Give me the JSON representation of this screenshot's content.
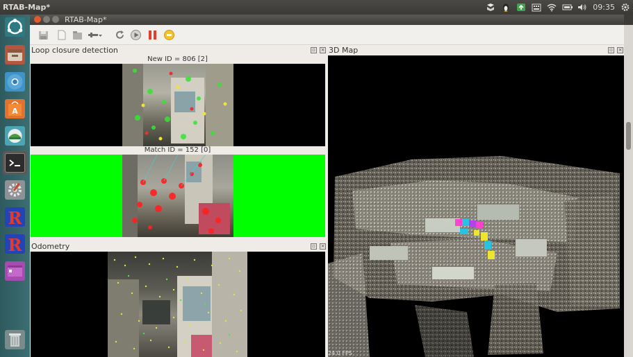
{
  "topbar": {
    "app_title": "RTAB-Map*",
    "time": "09:35",
    "icons": [
      "dropbox-icon",
      "tux-icon",
      "updater-icon",
      "keyboard-icon",
      "wifi-icon",
      "battery-icon",
      "volume-icon",
      "gear-icon"
    ]
  },
  "launcher": {
    "items": [
      "ubuntu-dash-icon",
      "files-icon",
      "chromium-icon",
      "software-center-icon",
      "system-monitor-icon",
      "terminal-icon",
      "system-settings-icon",
      "rtabmap-icon",
      "rtabmap-icon-2",
      "workspace-icon",
      "trash-icon"
    ]
  },
  "window": {
    "title": "RTAB-Map*"
  },
  "toolbar": {
    "buttons": [
      "save-icon",
      "new-icon",
      "open-icon",
      "dropdown-icon",
      "refresh-icon",
      "play-icon",
      "pause-icon",
      "stop-icon"
    ]
  },
  "loop_dock": {
    "title": "Loop closure detection",
    "new_id": "New ID = 806 [2]",
    "match_id": "Match ID = 152 [0]"
  },
  "odom_dock": {
    "title": "Odometry"
  },
  "map_dock": {
    "title": "3D Map",
    "fps": "24.0 FPS"
  },
  "colors": {
    "match_bg": "#00ff00",
    "panel_bg": "#000000",
    "launcher": "#3c6e72"
  }
}
